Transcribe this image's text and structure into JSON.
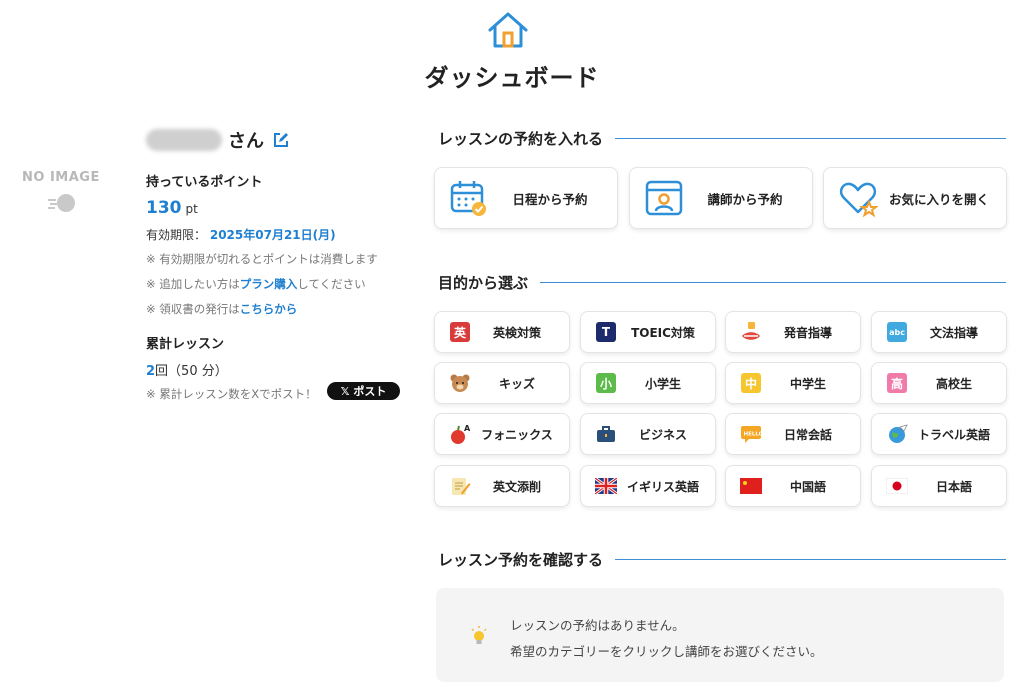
{
  "header": {
    "title": "ダッシュボード",
    "icon": "home-icon"
  },
  "profile": {
    "avatar_text": "NO IMAGE",
    "name_suffix": "さん",
    "points_label": "持っているポイント",
    "points_value": "130",
    "points_unit": "pt",
    "expiry_label": "有効期限：",
    "expiry_date": "2025年07月21日(月)",
    "notes": [
      {
        "prefix": "※ 有効期限が切れるとポイントは消費します",
        "link": "",
        "suffix": ""
      },
      {
        "prefix": "※ 追加したい方は",
        "link": "プラン購入",
        "suffix": "してください"
      },
      {
        "prefix": "※ 領収書の発行は",
        "link": "こちらから",
        "suffix": ""
      }
    ],
    "lessons_label": "累計レッスン",
    "lessons_count": "2",
    "lessons_rest": "回（50 分）",
    "share_note": "※ 累計レッスン数をXでポスト！",
    "x_post_label": "𝕏 ポスト"
  },
  "reserve": {
    "heading": "レッスンの予約を入れる",
    "buttons": [
      {
        "label": "日程から予約",
        "icon": "calendar-icon"
      },
      {
        "label": "講師から予約",
        "icon": "teacher-icon"
      },
      {
        "label": "お気に入りを開く",
        "icon": "favorite-heart-icon"
      }
    ]
  },
  "purpose": {
    "heading": "目的から選ぶ",
    "items": [
      {
        "label": "英検対策",
        "icon": "eiken-icon"
      },
      {
        "label": "TOEIC対策",
        "icon": "toeic-icon"
      },
      {
        "label": "発音指導",
        "icon": "pronunciation-icon"
      },
      {
        "label": "文法指導",
        "icon": "grammar-icon"
      },
      {
        "label": "キッズ",
        "icon": "bear-icon"
      },
      {
        "label": "小学生",
        "icon": "elementary-icon"
      },
      {
        "label": "中学生",
        "icon": "junior-high-icon"
      },
      {
        "label": "高校生",
        "icon": "high-school-icon"
      },
      {
        "label": "フォニックス",
        "icon": "phonics-apple-icon"
      },
      {
        "label": "ビジネス",
        "icon": "briefcase-icon"
      },
      {
        "label": "日常会話",
        "icon": "hello-bubble-icon"
      },
      {
        "label": "トラベル英語",
        "icon": "globe-plane-icon"
      },
      {
        "label": "英文添削",
        "icon": "writing-pad-icon"
      },
      {
        "label": "イギリス英語",
        "icon": "uk-flag-icon"
      },
      {
        "label": "中国語",
        "icon": "china-flag-icon"
      },
      {
        "label": "日本語",
        "icon": "japan-flag-icon"
      }
    ]
  },
  "confirm": {
    "heading": "レッスン予約を確認する",
    "line1": "レッスンの予約はありません。",
    "line2": "希望のカテゴリーをクリックし講師をお選びください。",
    "icon": "lightbulb-icon"
  },
  "colors": {
    "accent": "#1f7fd0",
    "orange": "#f0a030"
  }
}
